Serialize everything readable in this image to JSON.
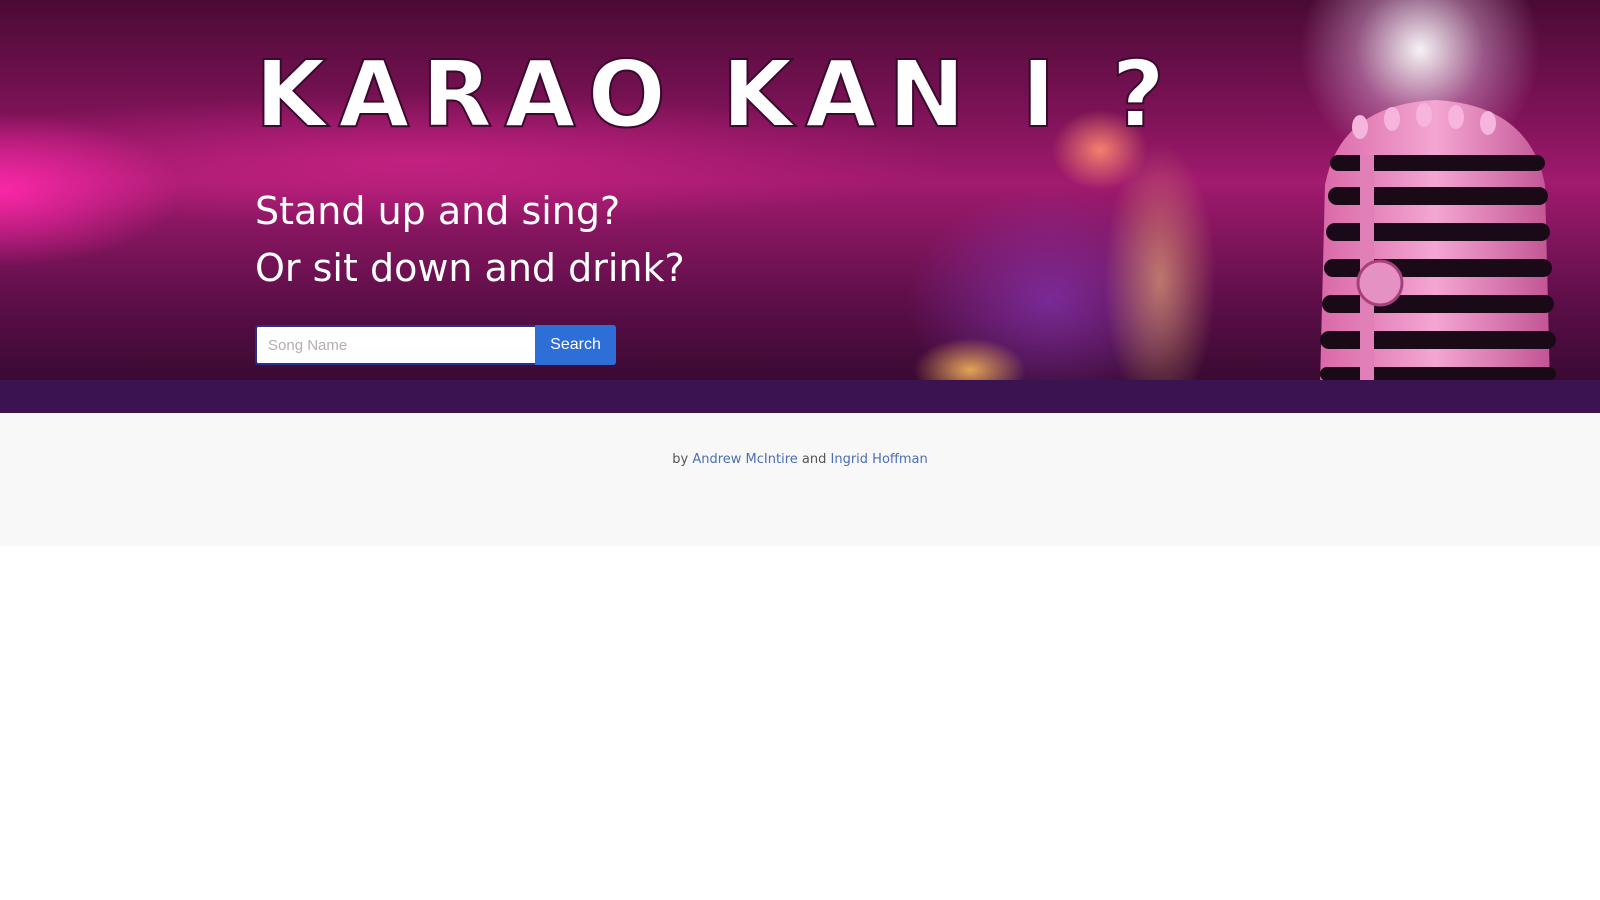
{
  "hero": {
    "title": "KARAO KAN I ?",
    "tagline_line1": "Stand up and sing?",
    "tagline_line2": "Or sit down and drink?",
    "background_image": "karaoke-microphone-pink-stage"
  },
  "search": {
    "placeholder": "Song Name",
    "value": "",
    "button_label": "Search"
  },
  "footer": {
    "prefix": "by",
    "author1": "Andrew McIntire",
    "joiner": "and",
    "author2": "Ingrid Hoffman"
  },
  "colors": {
    "hero_band": "#3a1350",
    "search_button": "#2d6fd6",
    "footer_background": "#f8f8f8",
    "link": "#4a6fb5"
  }
}
